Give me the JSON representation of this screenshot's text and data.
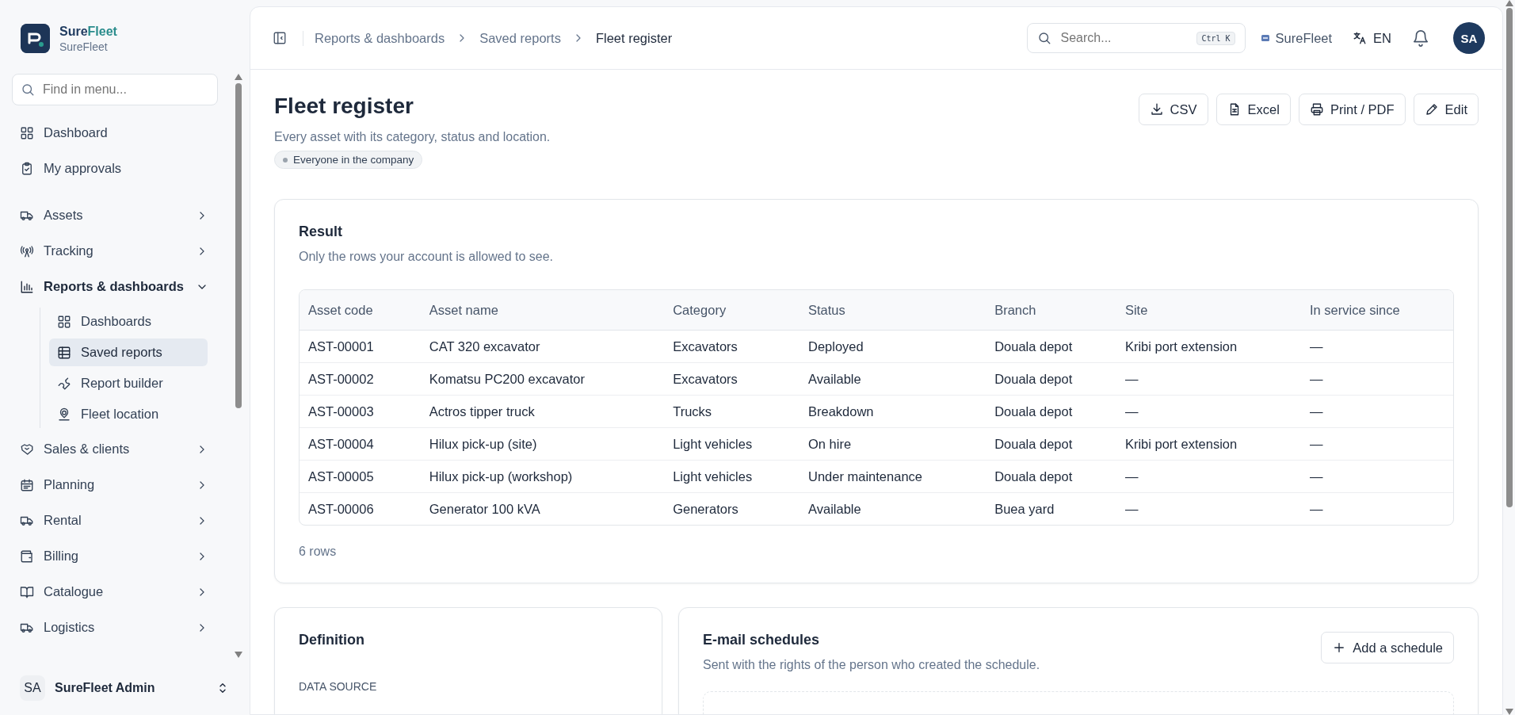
{
  "sidebar": {
    "brand": {
      "name": "Sure",
      "name_accent": "Fleet",
      "subtitle": "SureFleet"
    },
    "search": {
      "placeholder": "Find in menu..."
    },
    "items": [
      {
        "kind": "link",
        "label": "Dashboard"
      },
      {
        "kind": "link",
        "label": "My approvals"
      },
      {
        "kind": "group",
        "label": "Assets",
        "expanded": false
      },
      {
        "kind": "group",
        "label": "Tracking",
        "expanded": false
      },
      {
        "kind": "group",
        "label": "Reports & dashboards",
        "expanded": true,
        "children": [
          {
            "label": "Dashboards",
            "selected": false
          },
          {
            "label": "Saved reports",
            "selected": true
          },
          {
            "label": "Report builder",
            "selected": false
          },
          {
            "label": "Fleet location",
            "selected": false
          }
        ]
      },
      {
        "kind": "group",
        "label": "Sales & clients",
        "expanded": false
      },
      {
        "kind": "group",
        "label": "Planning",
        "expanded": false
      },
      {
        "kind": "group",
        "label": "Rental",
        "expanded": false
      },
      {
        "kind": "group",
        "label": "Billing",
        "expanded": false
      },
      {
        "kind": "group",
        "label": "Catalogue",
        "expanded": false
      },
      {
        "kind": "group",
        "label": "Logistics",
        "expanded": false
      }
    ],
    "user": {
      "initials": "SA",
      "name": "SureFleet Admin"
    }
  },
  "header": {
    "breadcrumbs": [
      "Reports & dashboards",
      "Saved reports",
      "Fleet register"
    ],
    "search": {
      "placeholder": "Search...",
      "shortcut": "Ctrl K"
    },
    "company": "SureFleet",
    "language": "EN",
    "avatar": "SA"
  },
  "page": {
    "title": "Fleet register",
    "subtitle": "Every asset with its category, status and location.",
    "visibility": "Everyone in the company",
    "actions": [
      "CSV",
      "Excel",
      "Print / PDF",
      "Edit"
    ]
  },
  "result": {
    "title": "Result",
    "subtitle": "Only the rows your account is allowed to see.",
    "table": {
      "columns": [
        "Asset code",
        "Asset name",
        "Category",
        "Status",
        "Branch",
        "Site",
        "In service since"
      ],
      "rows": [
        [
          "AST-00001",
          "CAT 320 excavator",
          "Excavators",
          "Deployed",
          "Douala depot",
          "Kribi port extension",
          "—"
        ],
        [
          "AST-00002",
          "Komatsu PC200 excavator",
          "Excavators",
          "Available",
          "Douala depot",
          "—",
          "—"
        ],
        [
          "AST-00003",
          "Actros tipper truck",
          "Trucks",
          "Breakdown",
          "Douala depot",
          "—",
          "—"
        ],
        [
          "AST-00004",
          "Hilux pick-up (site)",
          "Light vehicles",
          "On hire",
          "Douala depot",
          "Kribi port extension",
          "—"
        ],
        [
          "AST-00005",
          "Hilux pick-up (workshop)",
          "Light vehicles",
          "Under maintenance",
          "Douala depot",
          "—",
          "—"
        ],
        [
          "AST-00006",
          "Generator 100 kVA",
          "Generators",
          "Available",
          "Buea yard",
          "—",
          "—"
        ]
      ]
    },
    "row_count": "6 rows"
  },
  "definition": {
    "title": "Definition",
    "data_source_label": "DATA SOURCE"
  },
  "schedules": {
    "title": "E-mail schedules",
    "subtitle": "Sent with the rights of the person who created the schedule.",
    "add_button": "Add a schedule"
  }
}
